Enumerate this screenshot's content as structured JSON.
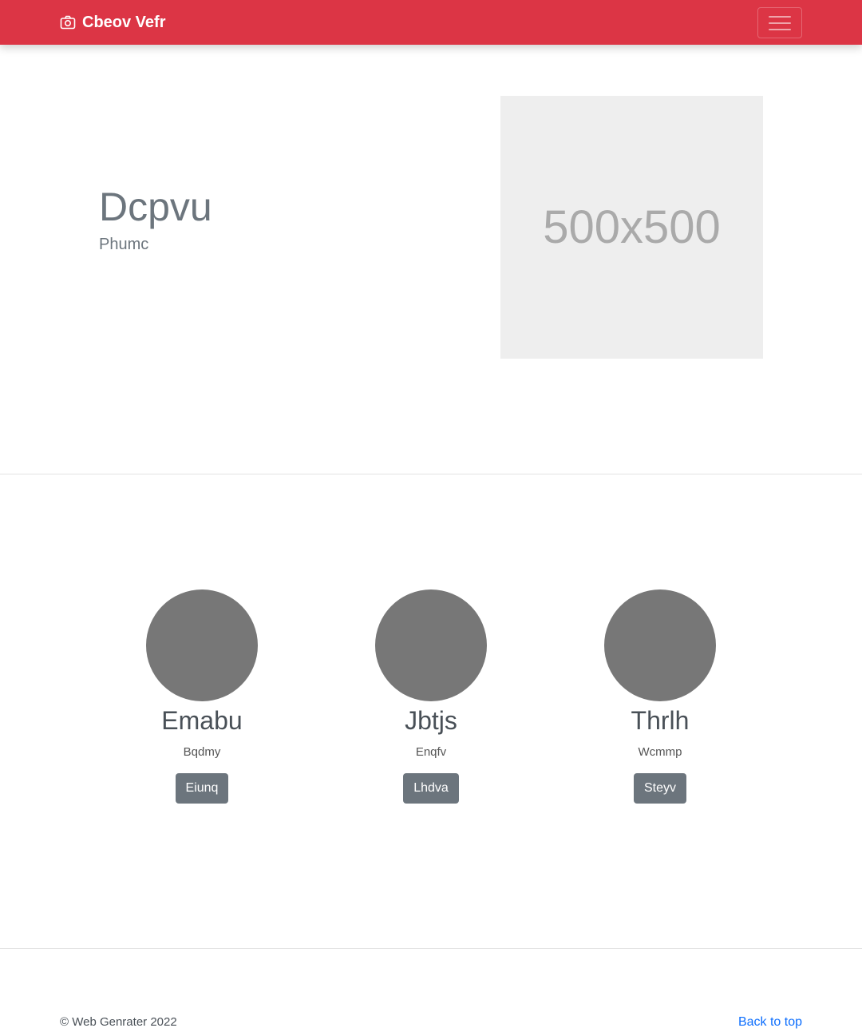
{
  "navbar": {
    "brand": "Cbeov Vefr",
    "brand_icon": "camera-icon",
    "toggler_icon": "hamburger-menu-icon",
    "background": "#dc3545"
  },
  "hero": {
    "title": "Dcpvu",
    "subtitle": "Phumc",
    "image_placeholder": "500x500"
  },
  "team": [
    {
      "name": "Emabu",
      "role": "Bqdmy",
      "button": "Eiunq"
    },
    {
      "name": "Jbtjs",
      "role": "Enqfv",
      "button": "Lhdva"
    },
    {
      "name": "Thrlh",
      "role": "Wcmmp",
      "button": "Steyv"
    }
  ],
  "footer": {
    "copyright": "© Web Genrater 2022",
    "back_to_top": "Back to top"
  },
  "colors": {
    "accent": "#dc3545",
    "secondary": "#6c757d",
    "link": "#0d6efd",
    "avatar": "#777777"
  }
}
